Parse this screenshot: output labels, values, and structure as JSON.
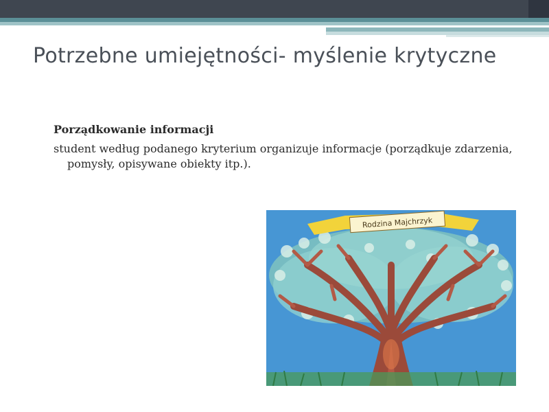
{
  "slide": {
    "title": "Potrzebne umiejętności- myślenie krytyczne",
    "content": {
      "heading": "Porządkowanie informacji",
      "body": "student według podanego kryterium organizuje informacje (porządkuje zdarzenia, pomysły, opisywane obiekty itp.)."
    },
    "image": {
      "banner_text": "Rodzina Majchrzyk",
      "colors": {
        "background": "#3e8fd0",
        "canopy": "#7cc0c0",
        "trunk": "#9b4a3a",
        "banner": "#f2d33a",
        "grass": "#4a9a5a"
      }
    },
    "colors": {
      "header_dark": "#3f4650",
      "header_teal": "#5b8f97",
      "title_text": "#4a5058"
    }
  }
}
